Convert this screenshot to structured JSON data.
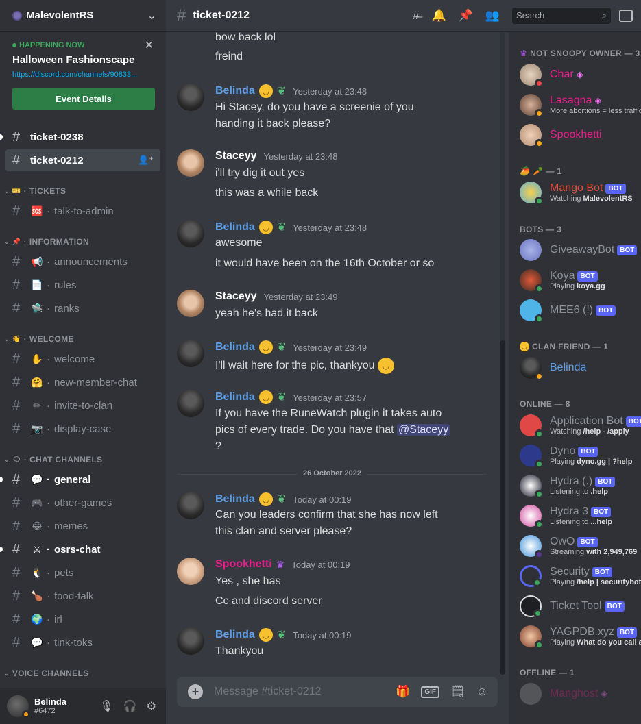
{
  "server": {
    "name": "MalevolentRS"
  },
  "event": {
    "status": "HAPPENING NOW",
    "title": "Halloween Fashionscape",
    "link": "https://discord.com/channels/90833...",
    "button": "Event Details"
  },
  "channels": {
    "top": [
      {
        "name": "ticket-0238",
        "unread": true
      },
      {
        "name": "ticket-0212",
        "active": true
      }
    ],
    "categories": [
      {
        "label": "TICKETS",
        "items": [
          {
            "emoji": "🆘",
            "name": "talk-to-admin"
          }
        ]
      },
      {
        "label": "INFORMATION",
        "items": [
          {
            "emoji": "📢",
            "name": "announcements"
          },
          {
            "emoji": "📄",
            "name": "rules"
          },
          {
            "emoji": "🛸",
            "name": "ranks"
          }
        ]
      },
      {
        "label": "WELCOME",
        "items": [
          {
            "emoji": "✋",
            "name": "welcome"
          },
          {
            "emoji": "🤗",
            "name": "new-member-chat"
          },
          {
            "emoji": "✏",
            "name": "invite-to-clan"
          },
          {
            "emoji": "📷",
            "name": "display-case"
          }
        ]
      },
      {
        "label": "CHAT CHANNELS",
        "items": [
          {
            "emoji": "💬",
            "name": "general",
            "unread": true
          },
          {
            "emoji": "🎮",
            "name": "other-games"
          },
          {
            "emoji": "😂",
            "name": "memes"
          },
          {
            "emoji": "⚔",
            "name": "osrs-chat",
            "unread": true
          },
          {
            "emoji": "🐧",
            "name": "pets"
          },
          {
            "emoji": "🍗",
            "name": "food-talk"
          },
          {
            "emoji": "🌍",
            "name": "irl"
          },
          {
            "emoji": "💬",
            "name": "tink-toks"
          }
        ]
      },
      {
        "label": "VOICE CHANNELS",
        "items": []
      }
    ]
  },
  "user": {
    "name": "Belinda",
    "discriminator": "#6472"
  },
  "header": {
    "channel": "ticket-0212",
    "search_placeholder": "Search"
  },
  "messages": {
    "m0": {
      "lines": [
        "bow back lol",
        "freind"
      ]
    },
    "m1": {
      "author": "Belinda",
      "ts": "Yesterday at 23:48",
      "lines": [
        "Hi Stacey, do you have a screenie of you",
        "handing it back please?"
      ]
    },
    "m2": {
      "author": "Staceyy",
      "ts": "Yesterday at 23:48",
      "lines": [
        "i'll try dig it out yes",
        "this was a while back"
      ]
    },
    "m3": {
      "author": "Belinda",
      "ts": "Yesterday at 23:48",
      "lines": [
        "awesome",
        "it would have been on the 16th October or so"
      ]
    },
    "m4": {
      "author": "Staceyy",
      "ts": "Yesterday at 23:49",
      "lines": [
        "yeah he's had it back"
      ]
    },
    "m5": {
      "author": "Belinda",
      "ts": "Yesterday at 23:49",
      "lines": [
        "I'll wait here for the pic, thankyou"
      ]
    },
    "m6": {
      "author": "Belinda",
      "ts": "Yesterday at 23:57",
      "lines": [
        "If you have the RuneWatch plugin it takes auto",
        "pics of every trade. Do you have that",
        "@Staceyy",
        "?"
      ]
    },
    "divider": "26 October 2022",
    "m7": {
      "author": "Belinda",
      "ts": "Today at 00:19",
      "lines": [
        "Can you leaders confirm that she has now left",
        "this clan and server please?"
      ]
    },
    "m8": {
      "author": "Spookhetti",
      "ts": "Today at 00:19",
      "lines": [
        "Yes , she has",
        "Cc and discord server"
      ]
    },
    "m9": {
      "author": "Belinda",
      "ts": "Today at 00:19",
      "lines": [
        "Thankyou"
      ]
    }
  },
  "composer": {
    "placeholder": "Message #ticket-0212",
    "gif": "GIF"
  },
  "members": {
    "g1": {
      "label": "NOT SNOOPY OWNER — 3"
    },
    "char": {
      "name": "Char"
    },
    "lasagna": {
      "name": "Lasagna",
      "activity": "More abortions = less traffic"
    },
    "spook": {
      "name": "Spookhetti"
    },
    "g2": {
      "label": "— 1"
    },
    "mango": {
      "name": "Mango Bot",
      "badge": "BOT",
      "activity_prefix": "Watching",
      "activity": "MalevolentRS"
    },
    "g3": {
      "label": "BOTS — 3"
    },
    "giveaway": {
      "name": "GiveawayBot",
      "badge": "BOT"
    },
    "koya": {
      "name": "Koya",
      "badge": "BOT",
      "activity_prefix": "Playing",
      "activity": "koya.gg"
    },
    "mee6": {
      "name": "MEE6 (!)",
      "badge": "BOT"
    },
    "g4": {
      "label": "CLAN FRIEND — 1"
    },
    "belinda": {
      "name": "Belinda"
    },
    "g5": {
      "label": "ONLINE — 8"
    },
    "appbot": {
      "name": "Application Bot",
      "badge": "BOT",
      "activity_prefix": "Watching",
      "activity": "/help - /apply"
    },
    "dyno": {
      "name": "Dyno",
      "badge": "BOT",
      "activity_prefix": "Playing",
      "activity": "dyno.gg | ?help"
    },
    "hydra": {
      "name": "Hydra (.)",
      "badge": "BOT",
      "activity_prefix": "Listening to",
      "activity": ".help"
    },
    "hydra3": {
      "name": "Hydra 3",
      "badge": "BOT",
      "activity_prefix": "Listening to",
      "activity": "...help"
    },
    "owo": {
      "name": "OwO",
      "badge": "BOT",
      "activity_prefix": "Streaming",
      "activity": "with 2,949,769"
    },
    "security": {
      "name": "Security",
      "badge": "BOT",
      "activity_prefix": "Playing",
      "activity": "/help | securitybot"
    },
    "ticket": {
      "name": "Ticket Tool",
      "badge": "BOT"
    },
    "yagpdb": {
      "name": "YAGPDB.xyz",
      "badge": "BOT",
      "activity_prefix": "Playing",
      "activity": "What do you call a"
    },
    "g6": {
      "label": "OFFLINE — 1"
    },
    "manghost": {
      "name": "Manghost"
    }
  },
  "colors": {
    "belinda": "#5d9ee6",
    "staceyy": "#ffffff",
    "spookhetti": "#e91e8c",
    "char": "#e91e8c",
    "mango": "#e74c3c",
    "bot_gray": "#8e9297"
  }
}
